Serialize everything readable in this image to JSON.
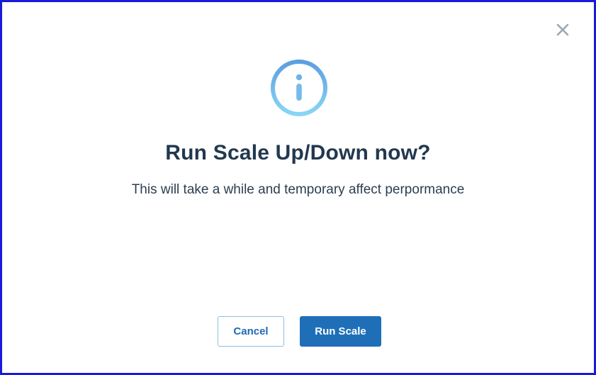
{
  "dialog": {
    "title": "Run Scale Up/Down now?",
    "message": "This will take a while and temporary affect perpormance",
    "icon": "info-icon",
    "close_icon": "close-icon",
    "buttons": {
      "cancel_label": "Cancel",
      "run_label": "Run Scale"
    }
  },
  "colors": {
    "primary": "#1f6fb8",
    "title": "#22384f",
    "icon_gradient_start": "#8ad6f5",
    "icon_gradient_end": "#5b9fe0",
    "frame_border": "#1a1adb"
  }
}
